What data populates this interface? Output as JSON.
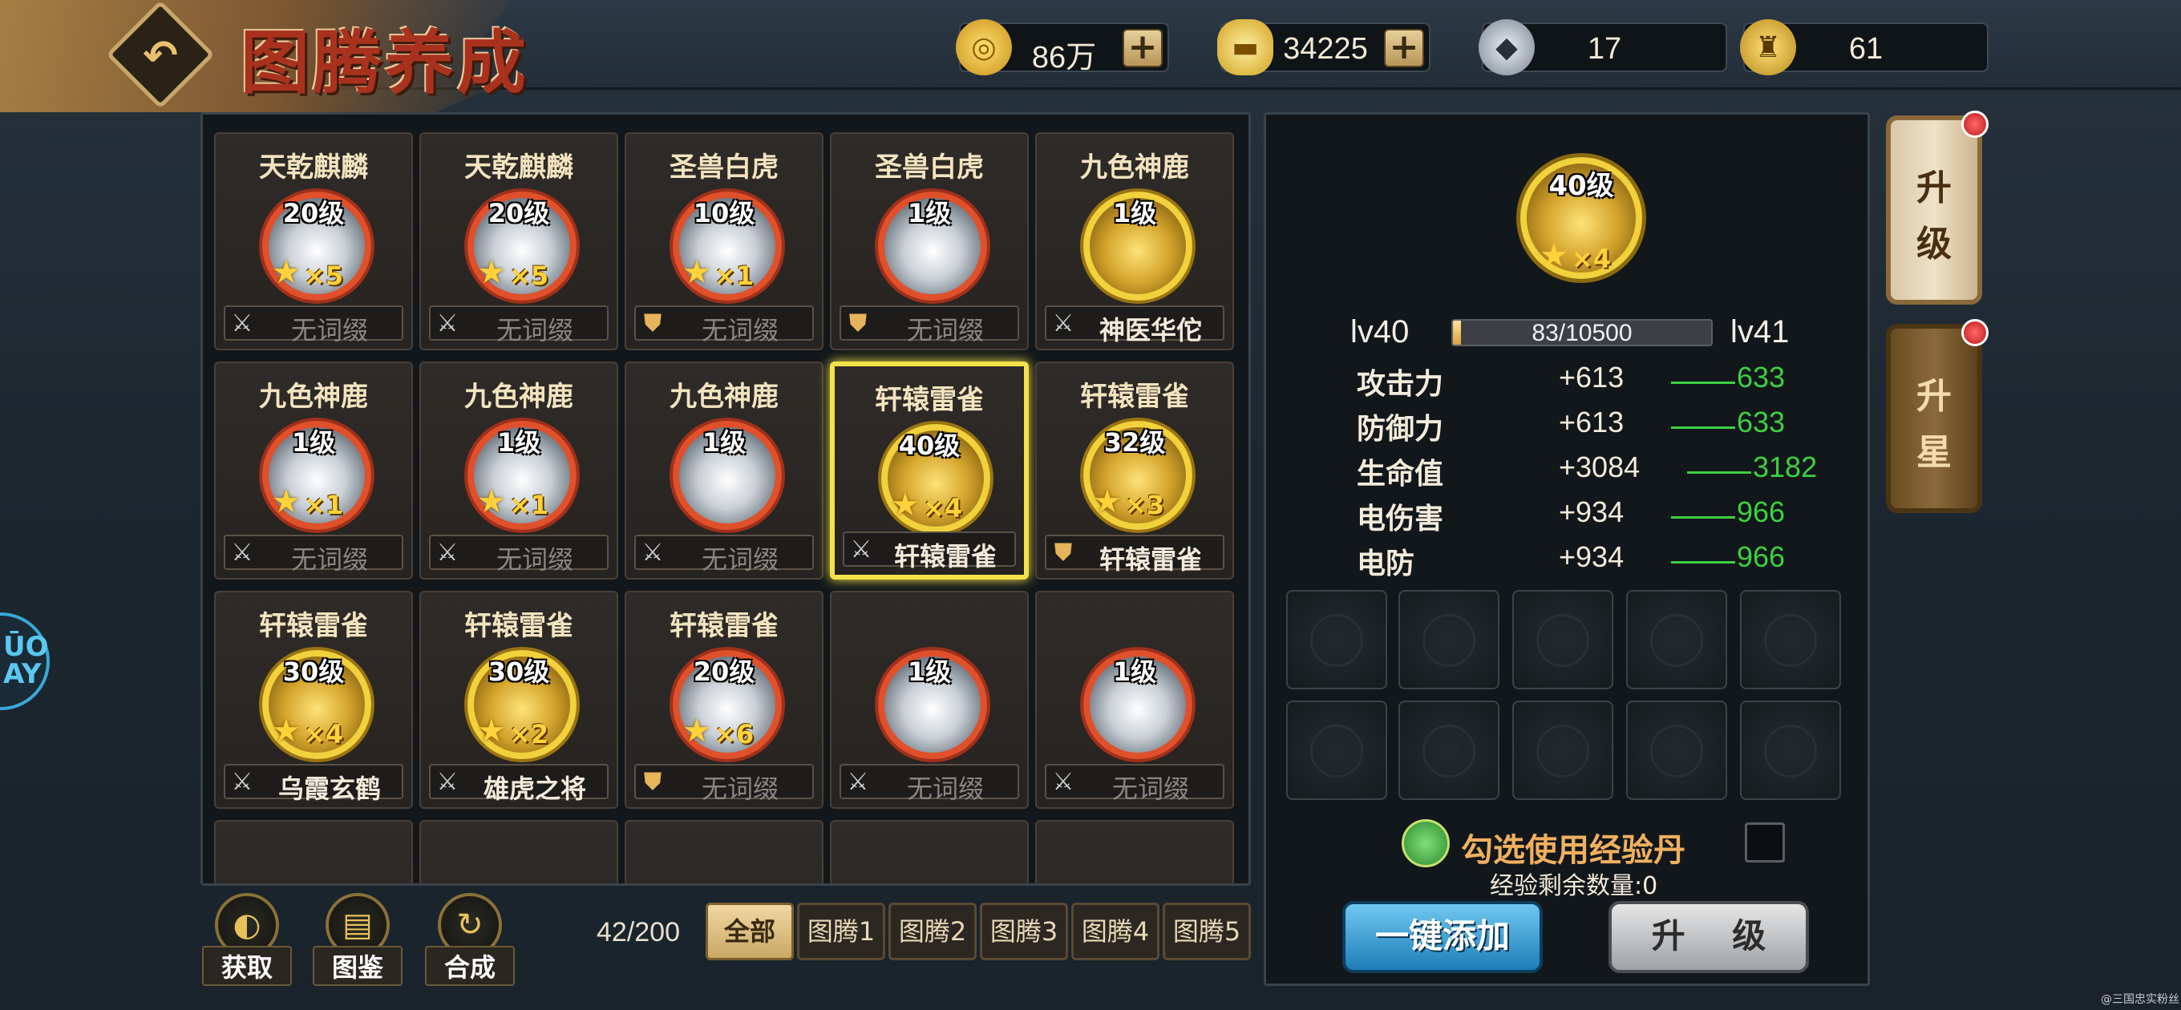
{
  "header": {
    "title": "图腾养成"
  },
  "resources": [
    {
      "icon": "gold-coin-icon",
      "value": "86万",
      "has_plus": true
    },
    {
      "icon": "ingot-icon",
      "value": "34225",
      "has_plus": true
    },
    {
      "icon": "wolf-token-icon",
      "value": "17",
      "has_plus": false
    },
    {
      "icon": "statue-token-icon",
      "value": "61",
      "has_plus": false
    }
  ],
  "cards": [
    {
      "name": "天乾麒麟",
      "level": "20级",
      "stars": "×5",
      "emblem": "white",
      "affix_icon": "sword",
      "affix": "无词缀",
      "named": false
    },
    {
      "name": "天乾麒麟",
      "level": "20级",
      "stars": "×5",
      "emblem": "white",
      "affix_icon": "sword",
      "affix": "无词缀",
      "named": false
    },
    {
      "name": "圣兽白虎",
      "level": "10级",
      "stars": "×1",
      "emblem": "white",
      "affix_icon": "shield",
      "affix": "无词缀",
      "named": false
    },
    {
      "name": "圣兽白虎",
      "level": "1级",
      "stars": "",
      "emblem": "white",
      "affix_icon": "shield",
      "affix": "无词缀",
      "named": false
    },
    {
      "name": "九色神鹿",
      "level": "1级",
      "stars": "",
      "emblem": "gold",
      "affix_icon": "sword",
      "affix": "神医华佗",
      "named": true
    },
    {
      "name": "九色神鹿",
      "level": "1级",
      "stars": "×1",
      "emblem": "white",
      "affix_icon": "sword",
      "affix": "无词缀",
      "named": false
    },
    {
      "name": "九色神鹿",
      "level": "1级",
      "stars": "×1",
      "emblem": "white",
      "affix_icon": "sword",
      "affix": "无词缀",
      "named": false
    },
    {
      "name": "九色神鹿",
      "level": "1级",
      "stars": "",
      "emblem": "white",
      "affix_icon": "sword",
      "affix": "无词缀",
      "named": false
    },
    {
      "name": "轩辕雷雀",
      "level": "40级",
      "stars": "×4",
      "emblem": "gold",
      "affix_icon": "sword",
      "affix": "轩辕雷雀",
      "named": true,
      "selected": true
    },
    {
      "name": "轩辕雷雀",
      "level": "32级",
      "stars": "×3",
      "emblem": "gold",
      "affix_icon": "shield",
      "affix": "轩辕雷雀",
      "named": true
    },
    {
      "name": "轩辕雷雀",
      "level": "30级",
      "stars": "×4",
      "emblem": "gold",
      "affix_icon": "sword",
      "affix": "乌霞玄鹤",
      "named": true
    },
    {
      "name": "轩辕雷雀",
      "level": "30级",
      "stars": "×2",
      "emblem": "gold",
      "affix_icon": "sword",
      "affix": "雄虎之将",
      "named": true
    },
    {
      "name": "轩辕雷雀",
      "level": "20级",
      "stars": "×6",
      "emblem": "white",
      "affix_icon": "shield",
      "affix": "无词缀",
      "named": false
    },
    {
      "name": "",
      "level": "1级",
      "stars": "",
      "emblem": "white",
      "affix_icon": "sword",
      "affix": "无词缀",
      "named": false
    },
    {
      "name": "",
      "level": "1级",
      "stars": "",
      "emblem": "white",
      "affix_icon": "sword",
      "affix": "无词缀",
      "named": false
    }
  ],
  "tools": [
    {
      "icon": "obtain-icon",
      "label": "获取"
    },
    {
      "icon": "catalog-icon",
      "label": "图鉴"
    },
    {
      "icon": "synthesize-icon",
      "label": "合成"
    }
  ],
  "inventory_count": "42/200",
  "filter_tabs": [
    "全部",
    "图腾1",
    "图腾2",
    "图腾3",
    "图腾4",
    "图腾5"
  ],
  "detail": {
    "level": "40级",
    "stars": "×4",
    "lv_current": "lv40",
    "lv_next": "lv41",
    "xp_text": "83/10500",
    "xp_fraction": 0.008,
    "stats": [
      {
        "name": "攻击力",
        "current": "+613",
        "next": "633"
      },
      {
        "name": "防御力",
        "current": "+613",
        "next": "633"
      },
      {
        "name": "生命值",
        "current": "+3084",
        "next": "3182"
      },
      {
        "name": "电伤害",
        "current": "+934",
        "next": "966"
      },
      {
        "name": "电防",
        "current": "+934",
        "next": "966"
      }
    ],
    "exp_pill_label": "勾选使用经验丹",
    "exp_remaining": "经验剩余数量:0",
    "one_click_add": "一键添加",
    "upgrade": "升 级"
  },
  "side_tabs": [
    {
      "label": "升级",
      "active": true
    },
    {
      "label": "升星",
      "active": false
    }
  ],
  "left_float_text": "ŪO\nAY",
  "watermark": "@三国忠实粉丝",
  "colors": {
    "accent_gold": "#f2d23c",
    "stat_green": "#3cd040",
    "selected_border": "#f3e24a"
  }
}
